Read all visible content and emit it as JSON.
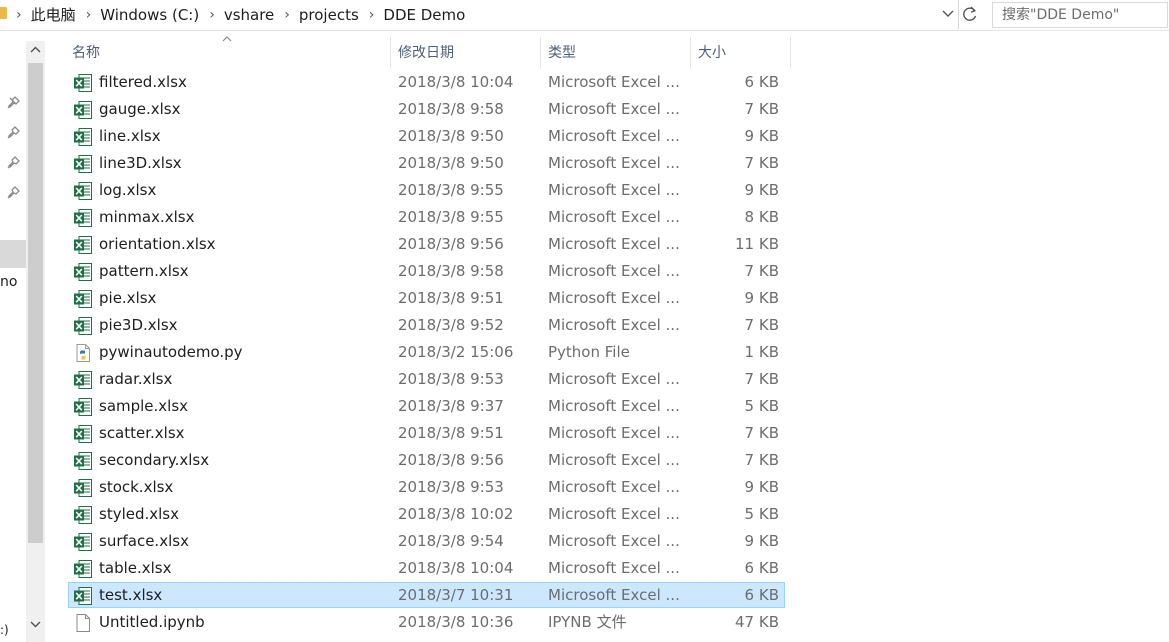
{
  "window": {
    "breadcrumb": [
      "此电脑",
      "Windows (C:)",
      "vshare",
      "projects",
      "DDE Demo"
    ],
    "search_placeholder": "搜索\"DDE Demo\""
  },
  "nav": {
    "partial_label": "no",
    "partial_label_bottom": ":)"
  },
  "columns": {
    "name": "名称",
    "date": "修改日期",
    "type": "类型",
    "size": "大小"
  },
  "files": [
    {
      "name": "filtered.xlsx",
      "date": "2018/3/8 10:04",
      "type": "Microsoft Excel ...",
      "size": "6 KB",
      "icon": "excel-file-icon"
    },
    {
      "name": "gauge.xlsx",
      "date": "2018/3/8 9:58",
      "type": "Microsoft Excel ...",
      "size": "7 KB",
      "icon": "excel-file-icon"
    },
    {
      "name": "line.xlsx",
      "date": "2018/3/8 9:50",
      "type": "Microsoft Excel ...",
      "size": "9 KB",
      "icon": "excel-file-icon"
    },
    {
      "name": "line3D.xlsx",
      "date": "2018/3/8 9:50",
      "type": "Microsoft Excel ...",
      "size": "7 KB",
      "icon": "excel-file-icon"
    },
    {
      "name": "log.xlsx",
      "date": "2018/3/8 9:55",
      "type": "Microsoft Excel ...",
      "size": "9 KB",
      "icon": "excel-file-icon"
    },
    {
      "name": "minmax.xlsx",
      "date": "2018/3/8 9:55",
      "type": "Microsoft Excel ...",
      "size": "8 KB",
      "icon": "excel-file-icon"
    },
    {
      "name": "orientation.xlsx",
      "date": "2018/3/8 9:56",
      "type": "Microsoft Excel ...",
      "size": "11 KB",
      "icon": "excel-file-icon"
    },
    {
      "name": "pattern.xlsx",
      "date": "2018/3/8 9:58",
      "type": "Microsoft Excel ...",
      "size": "7 KB",
      "icon": "excel-file-icon"
    },
    {
      "name": "pie.xlsx",
      "date": "2018/3/8 9:51",
      "type": "Microsoft Excel ...",
      "size": "9 KB",
      "icon": "excel-file-icon"
    },
    {
      "name": "pie3D.xlsx",
      "date": "2018/3/8 9:52",
      "type": "Microsoft Excel ...",
      "size": "7 KB",
      "icon": "excel-file-icon"
    },
    {
      "name": "pywinautodemo.py",
      "date": "2018/3/2 15:06",
      "type": "Python File",
      "size": "1 KB",
      "icon": "python-file-icon"
    },
    {
      "name": "radar.xlsx",
      "date": "2018/3/8 9:53",
      "type": "Microsoft Excel ...",
      "size": "7 KB",
      "icon": "excel-file-icon"
    },
    {
      "name": "sample.xlsx",
      "date": "2018/3/8 9:37",
      "type": "Microsoft Excel ...",
      "size": "5 KB",
      "icon": "excel-file-icon"
    },
    {
      "name": "scatter.xlsx",
      "date": "2018/3/8 9:51",
      "type": "Microsoft Excel ...",
      "size": "7 KB",
      "icon": "excel-file-icon"
    },
    {
      "name": "secondary.xlsx",
      "date": "2018/3/8 9:56",
      "type": "Microsoft Excel ...",
      "size": "7 KB",
      "icon": "excel-file-icon"
    },
    {
      "name": "stock.xlsx",
      "date": "2018/3/8 9:53",
      "type": "Microsoft Excel ...",
      "size": "9 KB",
      "icon": "excel-file-icon"
    },
    {
      "name": "styled.xlsx",
      "date": "2018/3/8 10:02",
      "type": "Microsoft Excel ...",
      "size": "5 KB",
      "icon": "excel-file-icon"
    },
    {
      "name": "surface.xlsx",
      "date": "2018/3/8 9:54",
      "type": "Microsoft Excel ...",
      "size": "9 KB",
      "icon": "excel-file-icon"
    },
    {
      "name": "table.xlsx",
      "date": "2018/3/8 10:04",
      "type": "Microsoft Excel ...",
      "size": "6 KB",
      "icon": "excel-file-icon"
    },
    {
      "name": "test.xlsx",
      "date": "2018/3/7 10:31",
      "type": "Microsoft Excel ...",
      "size": "6 KB",
      "icon": "excel-file-icon",
      "selected": true
    },
    {
      "name": "Untitled.ipynb",
      "date": "2018/3/8 10:36",
      "type": "IPYNB 文件",
      "size": "47 KB",
      "icon": "generic-file-icon"
    }
  ],
  "colors": {
    "selection_bg": "#cce8ff",
    "selection_border": "#99d1ff",
    "excel_green": "#1e7145",
    "header_text": "#4c607a"
  }
}
